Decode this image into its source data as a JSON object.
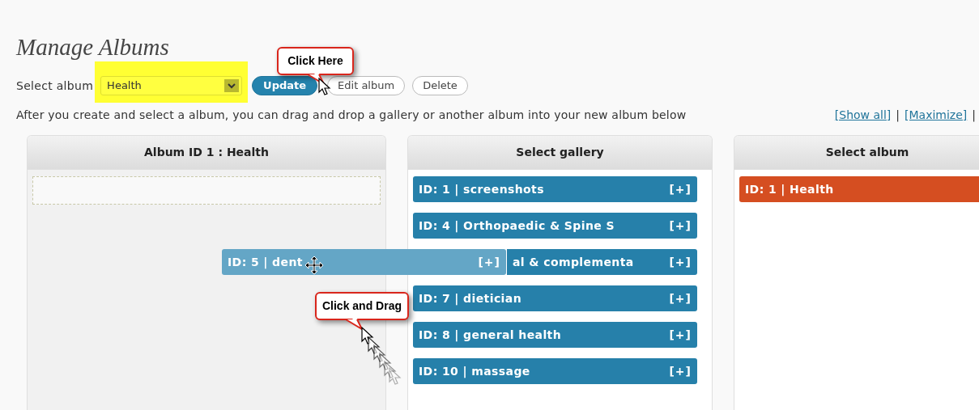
{
  "page": {
    "title": "Manage Albums"
  },
  "toolbar": {
    "label": "Select album",
    "select": {
      "value": "Health",
      "highlighted": true
    },
    "buttons": [
      {
        "label": "Update",
        "kind": "primary"
      },
      {
        "label": "Edit album",
        "kind": "secondary"
      },
      {
        "label": "Delete",
        "kind": "secondary"
      }
    ]
  },
  "instructions": "After you create and select a album, you can drag and drop a gallery or another album into your new album below",
  "links": [
    {
      "text": "[Show all]"
    },
    {
      "text": "[Maximize]"
    }
  ],
  "separators": [
    "|",
    "|"
  ],
  "album_panel": {
    "title": "Album ID 1 : Health"
  },
  "gallery_panel": {
    "title": "Select gallery",
    "items": [
      {
        "label": "ID: 1 | screenshots",
        "add": "[+]"
      },
      {
        "label": "ID: 4 | Orthopaedic & Spine S",
        "add": "[+]"
      },
      {
        "label": "al & complementa",
        "add": "[+]",
        "kind": "covered"
      },
      {
        "label": "ID: 7 | dietician",
        "add": "[+]"
      },
      {
        "label": "ID: 8 | general health",
        "add": "[+]"
      },
      {
        "label": "ID: 10 | massage",
        "add": "[+]"
      }
    ]
  },
  "album_list_panel": {
    "title": "Select album",
    "items": [
      {
        "label": "ID: 1 | Health"
      }
    ]
  },
  "dragged_item": {
    "label": "ID: 5 | dent",
    "add": "[+]"
  },
  "callouts": [
    {
      "text": "Click Here"
    },
    {
      "text": "Click and Drag"
    }
  ]
}
